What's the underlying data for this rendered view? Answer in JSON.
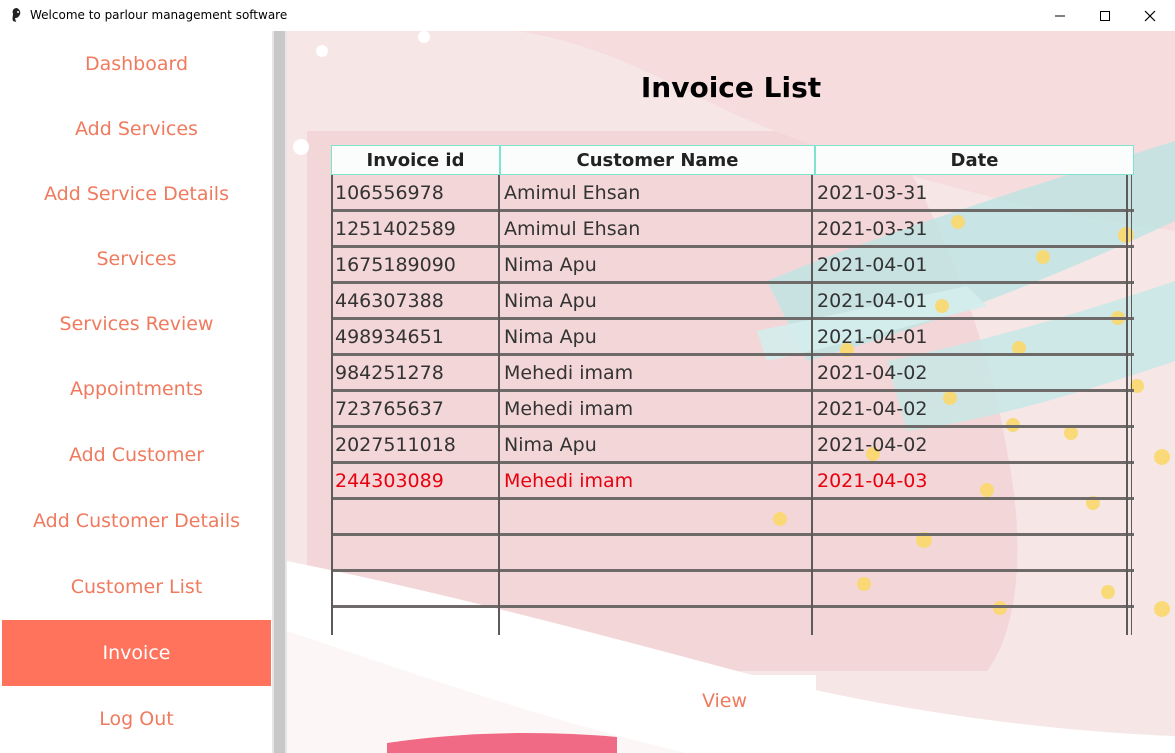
{
  "window": {
    "title": "Welcome to parlour management software"
  },
  "sidebar": {
    "items": [
      {
        "label": "Dashboard"
      },
      {
        "label": "Add Services"
      },
      {
        "label": "Add Service Details"
      },
      {
        "label": "Services"
      },
      {
        "label": "Services Review"
      },
      {
        "label": "Appointments"
      },
      {
        "label": "Add Customer"
      },
      {
        "label": "Add Customer Details"
      },
      {
        "label": "Customer List"
      },
      {
        "label": "Invoice"
      },
      {
        "label": "Log Out"
      }
    ],
    "active": "Invoice"
  },
  "main": {
    "title": "Invoice List",
    "table": {
      "columns": [
        "Invoice id",
        "Customer Name",
        "Date"
      ],
      "rows": [
        [
          "106556978",
          "Amimul Ehsan",
          "2021-03-31"
        ],
        [
          "1251402589",
          "Amimul Ehsan",
          "2021-03-31"
        ],
        [
          "1675189090",
          "Nima Apu",
          "2021-04-01"
        ],
        [
          "446307388",
          "Nima Apu",
          "2021-04-01"
        ],
        [
          "498934651",
          "Nima Apu",
          "2021-04-01"
        ],
        [
          "984251278",
          "Mehedi imam",
          "2021-04-02"
        ],
        [
          "723765637",
          "Mehedi imam",
          "2021-04-02"
        ],
        [
          "2027511018",
          "Nima Apu",
          "2021-04-02"
        ],
        [
          "244303089",
          "Mehedi imam",
          "2021-04-03"
        ]
      ],
      "selected_row": 8,
      "empty_rows": 4
    },
    "view_button": "View"
  },
  "colors": {
    "accent": "#ff735c",
    "nav_text": "#f07a5e",
    "selected_text": "#e8000f",
    "header_border": "#7fe3cf",
    "background_pink": "#f6e4e4",
    "teal_stroke": "#bfe3e3",
    "dots": "#fbd86b"
  }
}
